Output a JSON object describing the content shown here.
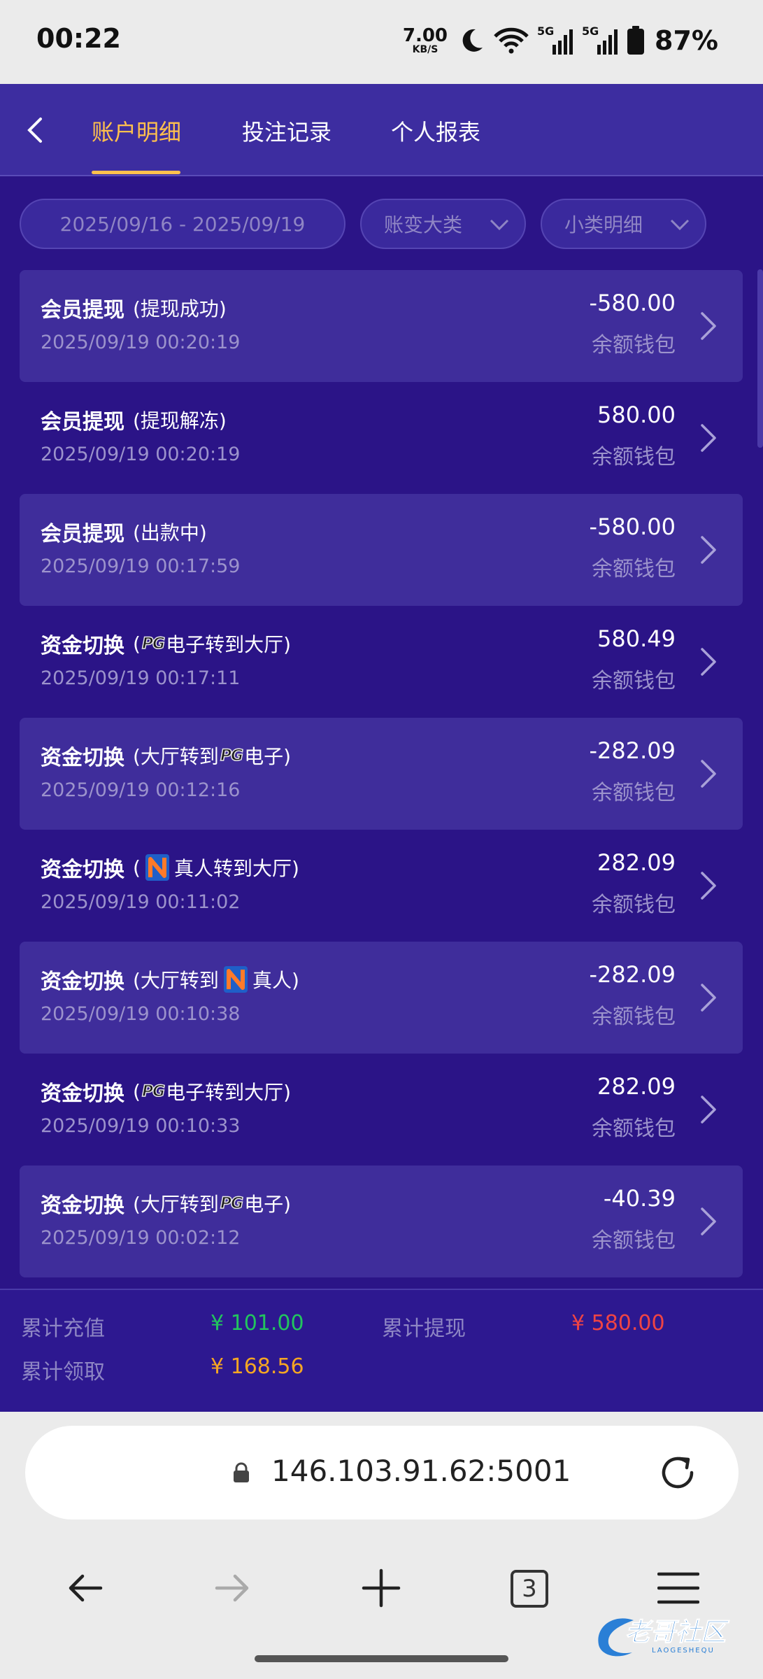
{
  "status_bar": {
    "time": "00:22",
    "net_speed": "7.00",
    "net_unit": "KB/S",
    "battery": "87%",
    "icons": [
      "moon-icon",
      "wifi-icon",
      "signal-5g-icon",
      "signal-5g-icon",
      "battery-icon"
    ]
  },
  "nav": {
    "tabs": [
      "账户明细",
      "投注记录",
      "个人报表"
    ],
    "active_tab": 0,
    "accent": "#ffc04d"
  },
  "filters": {
    "date_range": "2025/09/16 - 2025/09/19",
    "category": "账变大类",
    "subcategory": "小类明细"
  },
  "records": [
    {
      "title": "会员提现",
      "detail": [
        "(提现成功)"
      ],
      "time": "2025/09/19 00:20:19",
      "amount": "-580.00",
      "wallet": "余额钱包"
    },
    {
      "title": "会员提现",
      "detail": [
        "(提现解冻)"
      ],
      "time": "2025/09/19 00:20:19",
      "amount": "580.00",
      "wallet": "余额钱包"
    },
    {
      "title": "会员提现",
      "detail": [
        "(出款中)"
      ],
      "time": "2025/09/19 00:17:59",
      "amount": "-580.00",
      "wallet": "余额钱包"
    },
    {
      "title": "资金切换",
      "detail": [
        "(",
        "PG",
        "电子转到大厅)"
      ],
      "time": "2025/09/19 00:17:11",
      "amount": "580.49",
      "wallet": "余额钱包"
    },
    {
      "title": "资金切换",
      "detail": [
        "(大厅转到",
        "PG",
        "电子)"
      ],
      "time": "2025/09/19 00:12:16",
      "amount": "-282.09",
      "wallet": "余额钱包"
    },
    {
      "title": "资金切换",
      "detail": [
        "(",
        "N",
        "真人转到大厅)"
      ],
      "time": "2025/09/19 00:11:02",
      "amount": "282.09",
      "wallet": "余额钱包"
    },
    {
      "title": "资金切换",
      "detail": [
        "(大厅转到",
        "N",
        "真人)"
      ],
      "time": "2025/09/19 00:10:38",
      "amount": "-282.09",
      "wallet": "余额钱包"
    },
    {
      "title": "资金切换",
      "detail": [
        "(",
        "PG",
        "电子转到大厅)"
      ],
      "time": "2025/09/19 00:10:33",
      "amount": "282.09",
      "wallet": "余额钱包"
    },
    {
      "title": "资金切换",
      "detail": [
        "(大厅转到",
        "PG",
        "电子)"
      ],
      "time": "2025/09/19 00:02:12",
      "amount": "-40.39",
      "wallet": "余额钱包"
    }
  ],
  "summary": {
    "deposit_label": "累计充值",
    "deposit_value": "¥ 101.00",
    "withdraw_label": "累计提现",
    "withdraw_value": "¥ 580.00",
    "claim_label": "累计领取",
    "claim_value": "¥ 168.56",
    "colors": {
      "deposit": "#22c55e",
      "withdraw": "#ef4444",
      "claim": "#f5a623"
    }
  },
  "browser": {
    "url": "146.103.91.62:5001",
    "tab_count": "3"
  },
  "watermark": {
    "text": "老哥社区",
    "sub": "LAOGESHEQU"
  }
}
